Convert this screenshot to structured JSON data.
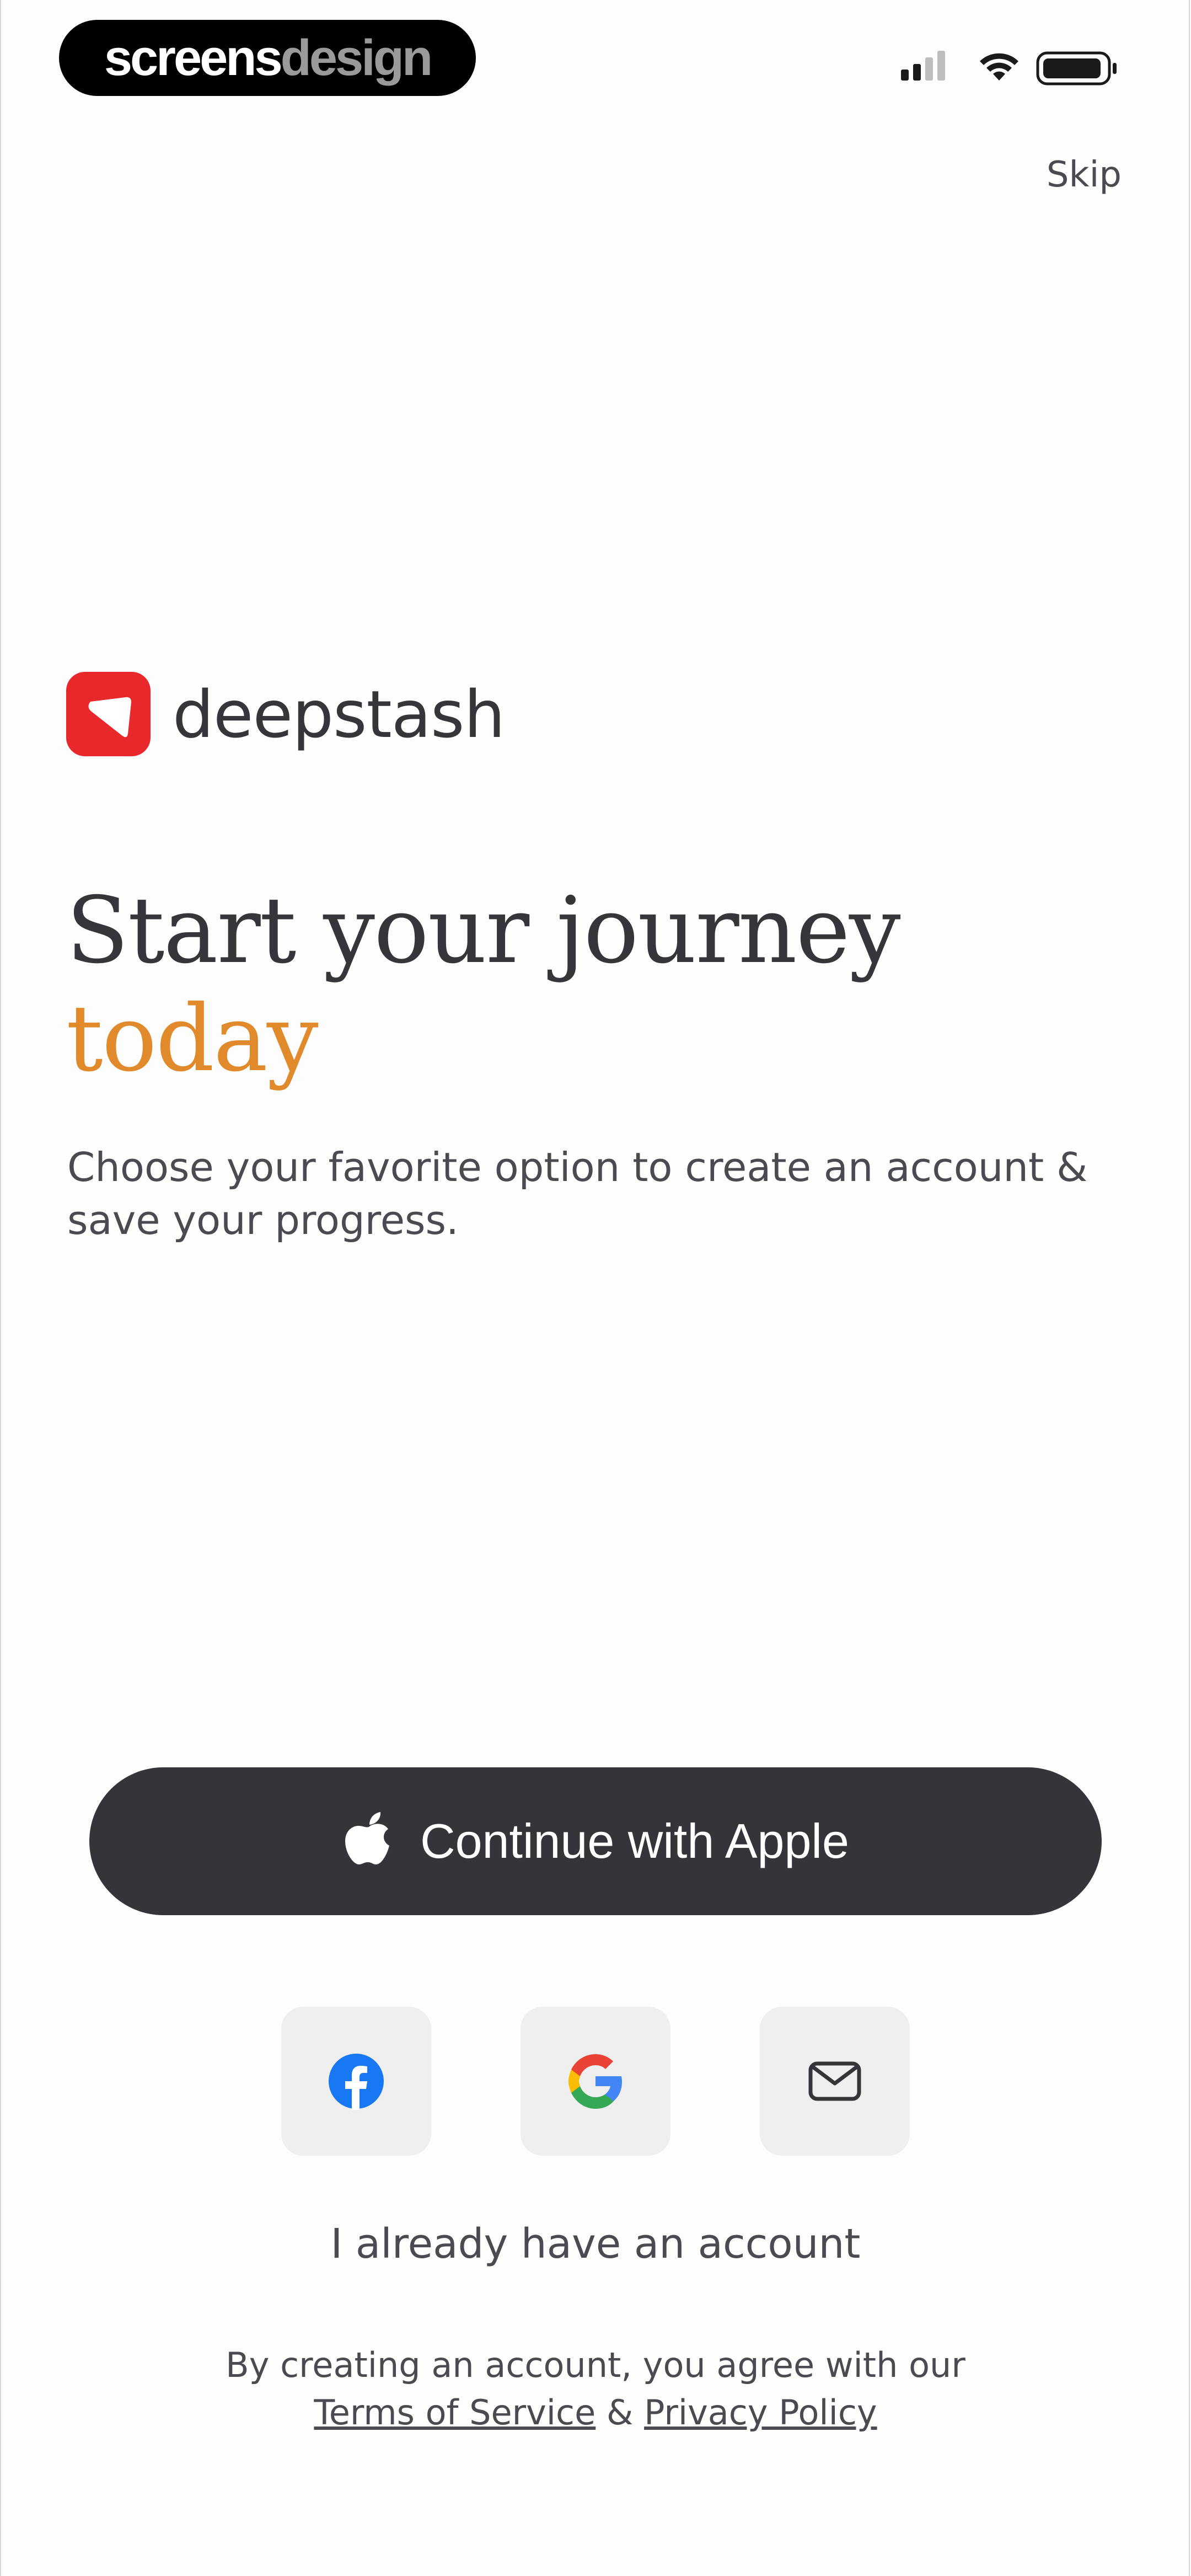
{
  "watermark": {
    "part1": "screens",
    "part2": "design"
  },
  "header": {
    "skip_label": "Skip"
  },
  "brand": {
    "name": "deepstash",
    "color": "#e8282b"
  },
  "hero": {
    "title_line1": "Start your journey",
    "title_line2": "today",
    "subtitle": "Choose your favorite option to create an account & save your progress."
  },
  "actions": {
    "apple_label": "Continue with Apple",
    "facebook_icon": "facebook-icon",
    "google_icon": "google-icon",
    "email_icon": "mail-icon",
    "login_label": "I already have an account"
  },
  "legal": {
    "prefix": "By creating an account, you agree with our",
    "terms": "Terms of Service",
    "separator": "&",
    "privacy": "Privacy Policy"
  },
  "colors": {
    "accent": "#e08a2c",
    "button_dark": "#333539",
    "social_bg": "#efefef"
  }
}
